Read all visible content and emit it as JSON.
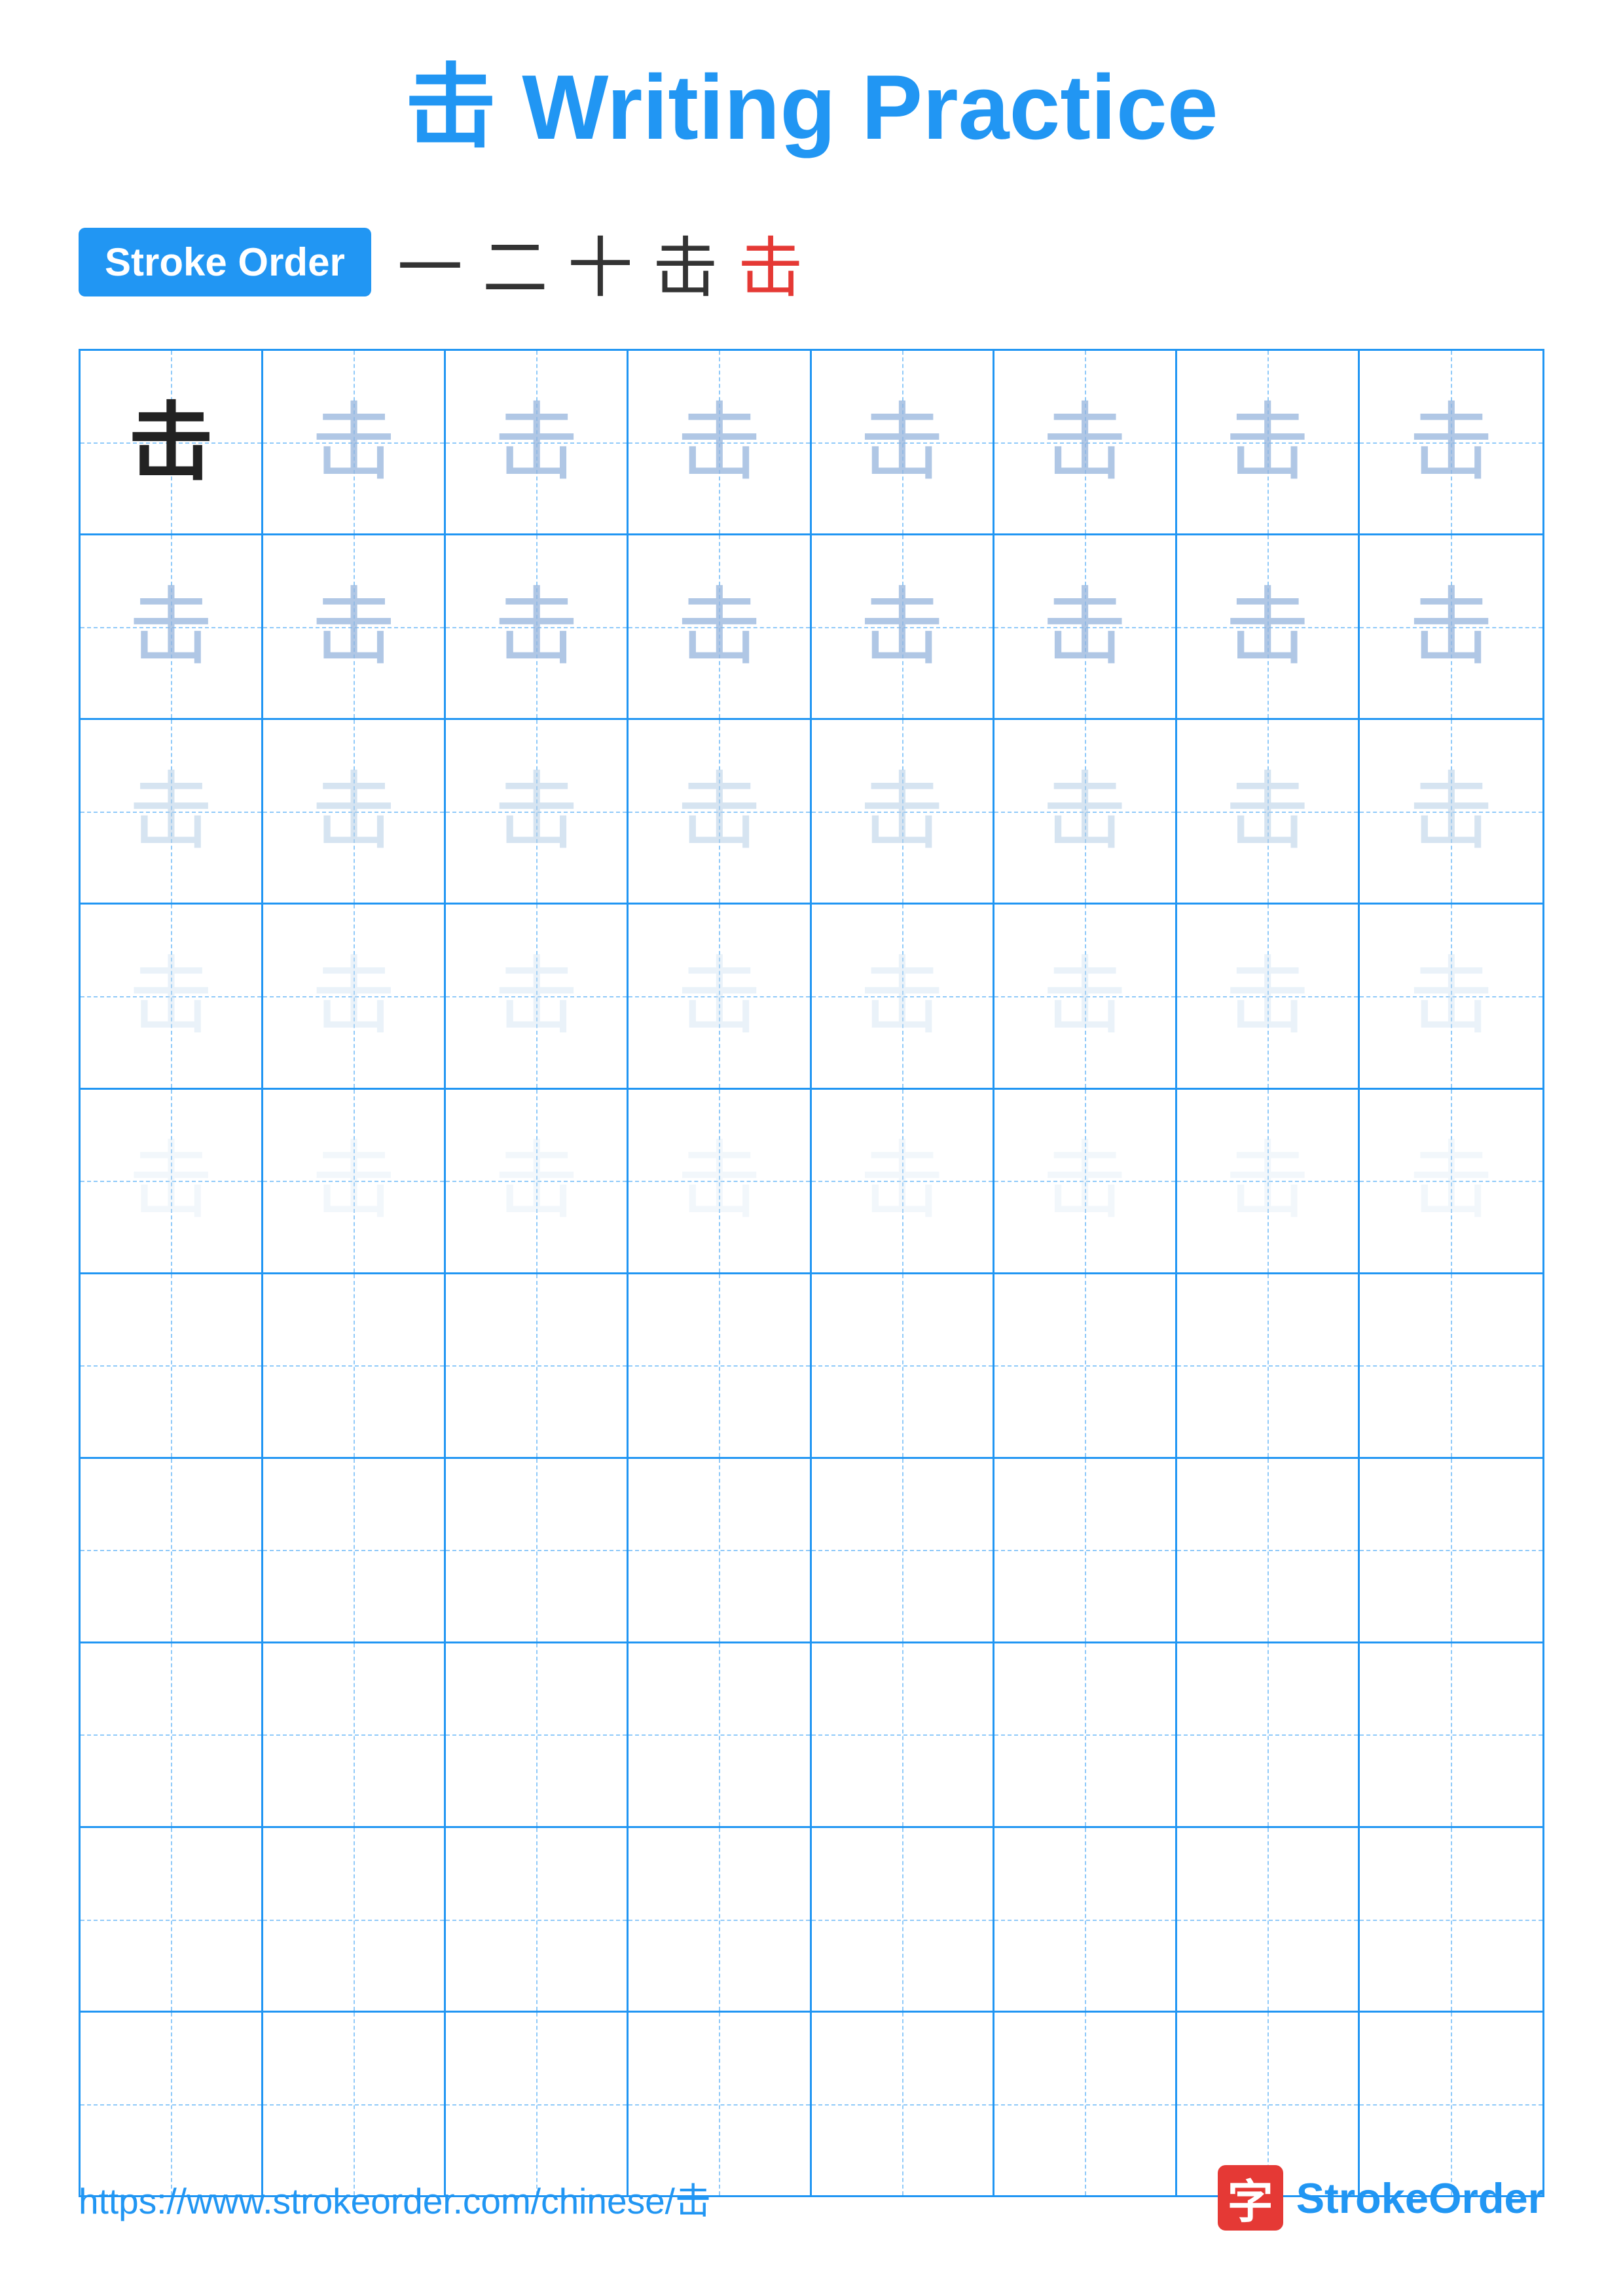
{
  "title": "击 Writing Practice",
  "stroke_order": {
    "label": "Stroke Order",
    "strokes": [
      "一",
      "二",
      "十",
      "击",
      "击"
    ]
  },
  "grid": {
    "rows": 10,
    "cols": 8,
    "character": "击",
    "row_styles": [
      [
        "dark",
        "medium",
        "medium",
        "medium",
        "medium",
        "medium",
        "medium",
        "medium"
      ],
      [
        "medium",
        "medium",
        "medium",
        "medium",
        "medium",
        "medium",
        "medium",
        "medium"
      ],
      [
        "light",
        "light",
        "light",
        "light",
        "light",
        "light",
        "light",
        "light"
      ],
      [
        "very-light",
        "very-light",
        "very-light",
        "very-light",
        "very-light",
        "very-light",
        "very-light",
        "very-light"
      ],
      [
        "faint",
        "faint",
        "faint",
        "faint",
        "faint",
        "faint",
        "faint",
        "faint"
      ],
      [
        "empty",
        "empty",
        "empty",
        "empty",
        "empty",
        "empty",
        "empty",
        "empty"
      ],
      [
        "empty",
        "empty",
        "empty",
        "empty",
        "empty",
        "empty",
        "empty",
        "empty"
      ],
      [
        "empty",
        "empty",
        "empty",
        "empty",
        "empty",
        "empty",
        "empty",
        "empty"
      ],
      [
        "empty",
        "empty",
        "empty",
        "empty",
        "empty",
        "empty",
        "empty",
        "empty"
      ],
      [
        "empty",
        "empty",
        "empty",
        "empty",
        "empty",
        "empty",
        "empty",
        "empty"
      ]
    ]
  },
  "footer": {
    "url": "https://www.strokeorder.com/chinese/击",
    "logo_char": "字",
    "logo_name": "StrokeOrder"
  }
}
